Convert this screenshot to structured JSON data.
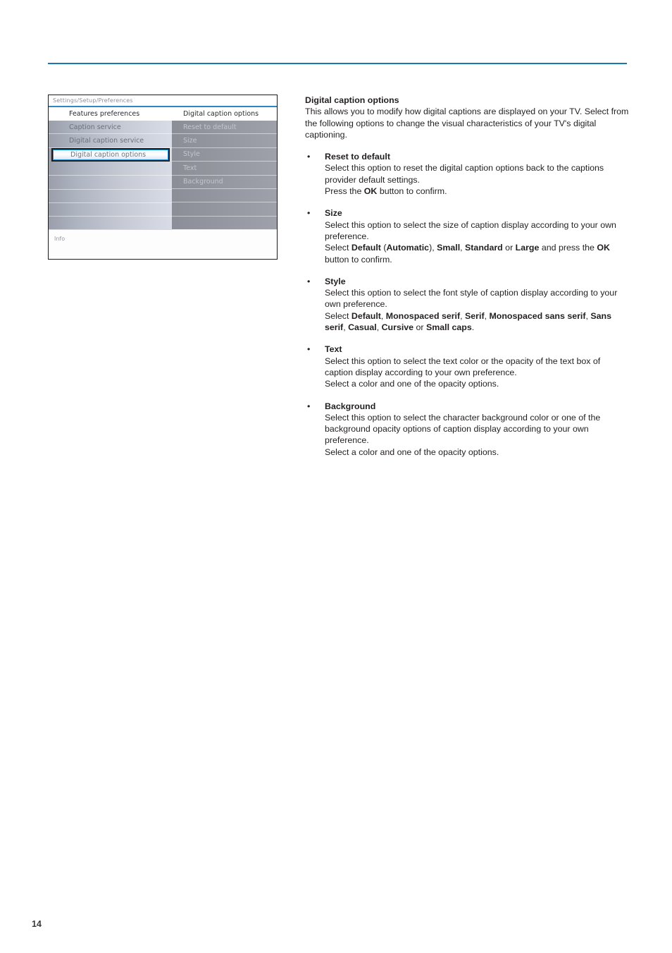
{
  "page": {
    "number": "14",
    "rule_color": "#1878b4"
  },
  "tv_menu": {
    "breadcrumb": "Settings/Setup/Preferences",
    "left_column": {
      "header": "Features preferences",
      "items": [
        {
          "label": "Caption service",
          "selected": false
        },
        {
          "label": "Digital caption service",
          "selected": false
        },
        {
          "label": "Digital caption options",
          "selected": true
        },
        {
          "label": "",
          "selected": false
        },
        {
          "label": "",
          "selected": false
        },
        {
          "label": "",
          "selected": false
        },
        {
          "label": "",
          "selected": false
        },
        {
          "label": "",
          "selected": false
        }
      ]
    },
    "right_column": {
      "header": "Digital caption options",
      "items": [
        {
          "label": "Reset to default"
        },
        {
          "label": "Size"
        },
        {
          "label": "Style"
        },
        {
          "label": "Text"
        },
        {
          "label": "Background"
        },
        {
          "label": ""
        },
        {
          "label": ""
        },
        {
          "label": ""
        }
      ]
    },
    "info_label": "Info",
    "selection_color": "#1a6fb5"
  },
  "doc": {
    "heading": "Digital caption options",
    "intro": "This allows you to modify how digital captions are displayed on your TV. Select from the following options to change the visual characteristics of your TV's digital captioning.",
    "bullet_glyph": "•",
    "sections": [
      {
        "title": "Reset to default",
        "lines": [
          {
            "type": "text",
            "value": "Select this option to reset the digital caption options back to the captions provider default settings."
          },
          {
            "type": "rich",
            "parts": [
              {
                "text": "Press the ",
                "bold": false
              },
              {
                "text": "OK",
                "bold": true
              },
              {
                "text": " button to confirm.",
                "bold": false
              }
            ]
          }
        ]
      },
      {
        "title": "Size",
        "lines": [
          {
            "type": "text",
            "value": "Select this option to select the size of caption display according to your own preference."
          },
          {
            "type": "rich",
            "parts": [
              {
                "text": "Select ",
                "bold": false
              },
              {
                "text": "Default",
                "bold": true
              },
              {
                "text": " (",
                "bold": false
              },
              {
                "text": "Automatic",
                "bold": true
              },
              {
                "text": "), ",
                "bold": false
              },
              {
                "text": "Small",
                "bold": true
              },
              {
                "text": ", ",
                "bold": false
              },
              {
                "text": "Standard",
                "bold": true
              },
              {
                "text": " or ",
                "bold": false
              },
              {
                "text": "Large",
                "bold": true
              },
              {
                "text": " and press the ",
                "bold": false
              },
              {
                "text": "OK",
                "bold": true
              },
              {
                "text": " button to confirm.",
                "bold": false
              }
            ]
          }
        ]
      },
      {
        "title": "Style",
        "lines": [
          {
            "type": "text",
            "value": "Select this option to select the font style of caption display according to your own preference."
          },
          {
            "type": "rich",
            "parts": [
              {
                "text": "Select ",
                "bold": false
              },
              {
                "text": "Default",
                "bold": true
              },
              {
                "text": ", ",
                "bold": false
              },
              {
                "text": "Monospaced serif",
                "bold": true
              },
              {
                "text": ", ",
                "bold": false
              },
              {
                "text": "Serif",
                "bold": true
              },
              {
                "text": ", ",
                "bold": false
              },
              {
                "text": "Monospaced sans serif",
                "bold": true
              },
              {
                "text": ", ",
                "bold": false
              },
              {
                "text": "Sans serif",
                "bold": true
              },
              {
                "text": ", ",
                "bold": false
              },
              {
                "text": "Casual",
                "bold": true
              },
              {
                "text": ", ",
                "bold": false
              },
              {
                "text": "Cursive",
                "bold": true
              },
              {
                "text": " or ",
                "bold": false
              },
              {
                "text": "Small caps",
                "bold": true
              },
              {
                "text": ".",
                "bold": false
              }
            ]
          }
        ]
      },
      {
        "title": "Text",
        "lines": [
          {
            "type": "text",
            "value": "Select this option to select the text color or the opacity of the text box of caption display according to your own preference."
          },
          {
            "type": "text",
            "value": "Select a color and one of the opacity options."
          }
        ]
      },
      {
        "title": "Background",
        "lines": [
          {
            "type": "text",
            "value": "Select this option to select the character background color or one of the background opacity options of caption display according to your own preference."
          },
          {
            "type": "text",
            "value": "Select a color and one of the opacity options."
          }
        ]
      }
    ]
  }
}
